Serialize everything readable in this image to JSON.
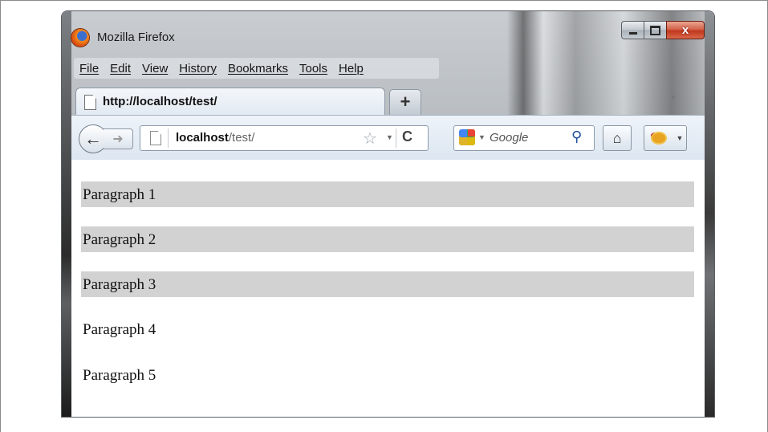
{
  "window": {
    "title": "Mozilla Firefox",
    "controls": {
      "minimize_icon": "minimize-icon",
      "maximize_icon": "maximize-icon",
      "close_icon": "close-icon",
      "close_glyph": "x"
    }
  },
  "menubar": {
    "items": [
      {
        "label": "File"
      },
      {
        "label": "Edit"
      },
      {
        "label": "View"
      },
      {
        "label": "History"
      },
      {
        "label": "Bookmarks"
      },
      {
        "label": "Tools"
      },
      {
        "label": "Help"
      }
    ]
  },
  "tabs": [
    {
      "title": "http://localhost/test/",
      "active": true
    }
  ],
  "newtab": {
    "glyph": "+"
  },
  "navbar": {
    "back_glyph": "←",
    "forward_glyph": "➜",
    "url": {
      "host": "localhost",
      "path": "/test/"
    },
    "star_glyph": "☆",
    "reload_glyph": "C",
    "search": {
      "engine": "Google",
      "placeholder": "Google"
    },
    "home_glyph": "⌂"
  },
  "content": {
    "paragraphs": [
      {
        "text": "Paragraph 1",
        "shaded": true
      },
      {
        "text": "Paragraph 2",
        "shaded": true
      },
      {
        "text": "Paragraph 3",
        "shaded": true
      },
      {
        "text": "Paragraph 4",
        "shaded": false
      },
      {
        "text": "Paragraph 5",
        "shaded": false
      }
    ],
    "shade_color": "#d2d2d2"
  }
}
